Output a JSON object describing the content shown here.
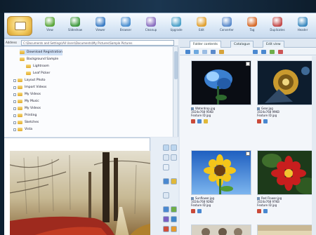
{
  "toolbar": {
    "items": [
      {
        "label": "View",
        "icon": "view-icon",
        "color": "#5aa63a"
      },
      {
        "label": "Slideshow",
        "icon": "slideshow-icon",
        "color": "#3f9a3f"
      },
      {
        "label": "Viewer",
        "icon": "viewer-icon",
        "color": "#3b7cc4"
      },
      {
        "label": "Browser",
        "icon": "browser-icon",
        "color": "#4b8fd0"
      },
      {
        "label": "Cleanup",
        "icon": "cleanup-icon",
        "color": "#8a6fc0"
      },
      {
        "label": "Upgrade",
        "icon": "upgrade-icon",
        "color": "#4aa0c8"
      },
      {
        "label": "Edit",
        "icon": "edit-icon",
        "color": "#e0a030"
      },
      {
        "label": "Converter",
        "icon": "converter-icon",
        "color": "#5a8acb"
      },
      {
        "label": "Tag",
        "icon": "tag-icon",
        "color": "#d66a2a"
      },
      {
        "label": "Duplicates",
        "icon": "duplicates-icon",
        "color": "#c34a4a"
      },
      {
        "label": "Header",
        "icon": "header-icon",
        "color": "#3b8ac0"
      }
    ]
  },
  "pathbar": {
    "label": "Address",
    "value": "C:\\Documents and Settings\\All Users\\Documents\\My Pictures\\Sample Pictures"
  },
  "tree": {
    "items": [
      {
        "label": "Download Registration",
        "indent": 2,
        "expand": false
      },
      {
        "label": "Background Sample",
        "indent": 2,
        "expand": false
      },
      {
        "label": "Lightroom",
        "indent": 3,
        "expand": false
      },
      {
        "label": "Leaf Picker",
        "indent": 3,
        "expand": false
      },
      {
        "label": "Layout Photo",
        "indent": 1,
        "expand": true
      },
      {
        "label": "Import Videos",
        "indent": 1,
        "expand": true
      },
      {
        "label": "My Videos",
        "indent": 1,
        "expand": true
      },
      {
        "label": "My Music",
        "indent": 1,
        "expand": true
      },
      {
        "label": "My Videos",
        "indent": 1,
        "expand": true
      },
      {
        "label": "Printing",
        "indent": 1,
        "expand": true
      },
      {
        "label": "Sketches",
        "indent": 1,
        "expand": true
      },
      {
        "label": "Vista",
        "indent": 1,
        "expand": true
      }
    ]
  },
  "right_panel": {
    "tabs": [
      "Folder contents",
      "Catalogue",
      "Edit view"
    ],
    "thumbnails": [
      {
        "name": "Waterdrop.jpg",
        "info": "1024x768  95KB",
        "date": "Feature ID jpg",
        "palette": "blue-flower"
      },
      {
        "name": "Gear.jpg",
        "info": "1024x768  99KB",
        "date": "Feature ID jpg",
        "palette": "gold-object"
      },
      {
        "name": "Sunflower.jpg",
        "info": "1024x768  92KB",
        "date": "Feature ID jpg",
        "palette": "sunflower"
      },
      {
        "name": "Red Flower.jpg",
        "info": "1024x768  97KB",
        "date": "Feature ID jpg",
        "palette": "red-flower"
      }
    ]
  },
  "colors": {
    "accent": "#3b7cc4",
    "ribbon": "#dbe8f6",
    "selection": "#cfe0f5"
  }
}
